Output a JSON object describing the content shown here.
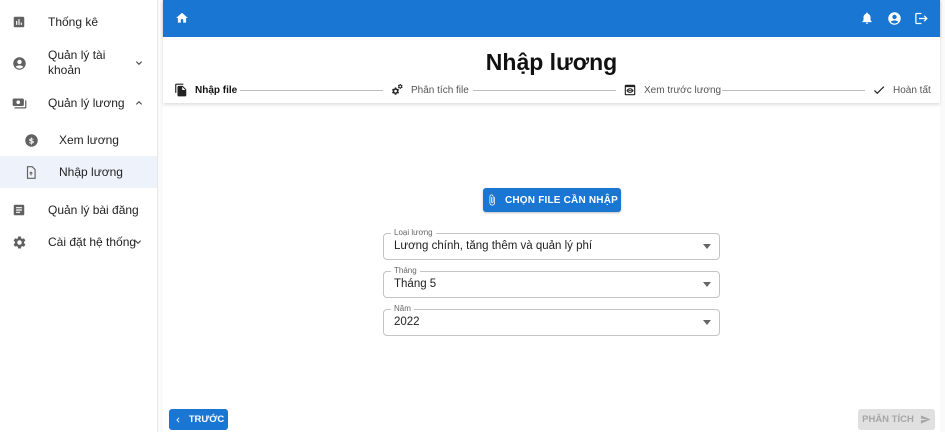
{
  "sidebar": {
    "items": [
      {
        "label": "Thống kê",
        "icon": "bar-chart-icon"
      },
      {
        "label": "Quản lý tài khoản",
        "line1": "Quản lý tài",
        "line2": "khoản",
        "icon": "account-circle-icon",
        "expanded": false
      },
      {
        "label": "Quản lý lương",
        "icon": "payments-icon",
        "expanded": true
      },
      {
        "label": "Xem lương",
        "icon": "dollar-circle-icon"
      },
      {
        "label": "Nhập lương",
        "icon": "file-upload-icon",
        "active": true
      },
      {
        "label": "Quản lý bài đăng",
        "icon": "article-icon"
      },
      {
        "label": "Cài đặt hệ thống",
        "icon": "gear-icon",
        "expanded": false
      }
    ]
  },
  "topbar": {
    "left_icon": "home-icon",
    "right_icons": [
      "bell-icon",
      "account-circle-icon",
      "logout-icon"
    ],
    "color": "#1976d2"
  },
  "page": {
    "title": "Nhập lương",
    "steps": [
      {
        "label": "Nhập file",
        "icon": "file-copy-icon",
        "active": true
      },
      {
        "label": "Phân tích file",
        "icon": "gears-icon"
      },
      {
        "label": "Xem trước lương",
        "icon": "preview-icon"
      },
      {
        "label": "Hoàn tất",
        "icon": "check-icon"
      }
    ],
    "choose_file_label": "CHỌN FILE CẦN NHẬP",
    "fields": {
      "salary_type": {
        "label": "Loại lương",
        "value": "Lương chính, tăng thêm và quản lý phí"
      },
      "month": {
        "label": "Tháng",
        "value": "Tháng 5"
      },
      "year": {
        "label": "Năm",
        "value": "2022"
      }
    },
    "back_label": "TRƯỚC",
    "next_label": "PHÂN TÍCH"
  },
  "colors": {
    "primary": "#1976d2",
    "active_bg": "#eef3fb",
    "disabled_bg": "#e0e0e0"
  }
}
